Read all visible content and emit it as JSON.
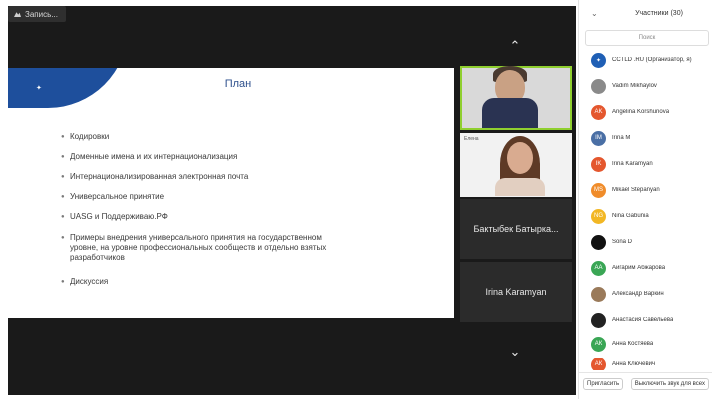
{
  "recording": {
    "label": "Запись..."
  },
  "slide": {
    "title": "План",
    "bullets": [
      "Кодировки",
      "Доменные имена и их интернационализация",
      "Интернационализированная электронная почта",
      "Универсальное принятие",
      "UASG и Поддерживаю.РФ",
      "Примеры внедрения универсального принятия на государственном уровне, на уровне профессиональных сообществ и отдельно взятых разработчиков",
      "Дискуссия"
    ]
  },
  "video_tiles": {
    "tile2_label": "Елена",
    "tile3_name": "Бактыбек Батырка...",
    "tile4_name": "Irina Karamyan"
  },
  "panel": {
    "title": "Участники (30)",
    "search_placeholder": "Поиск",
    "participants": [
      {
        "name": "CCTLD .RU (Организатор, я)",
        "initials": "",
        "color": "#1f5fb5"
      },
      {
        "name": "Vadim Mikhaylov",
        "initials": "",
        "color": "#8a8a8a"
      },
      {
        "name": "Angelina Korshunova",
        "initials": "AK",
        "color": "#e4572e"
      },
      {
        "name": "Irina M",
        "initials": "IM",
        "color": "#4a6fa5"
      },
      {
        "name": "Irina Karamyan",
        "initials": "IK",
        "color": "#e4572e"
      },
      {
        "name": "Mikael Stepanyan",
        "initials": "MS",
        "color": "#f08c2a"
      },
      {
        "name": "Nina Gabunia",
        "initials": "NG",
        "color": "#f2b724"
      },
      {
        "name": "Sona D",
        "initials": "",
        "color": "#111111"
      },
      {
        "name": "Айгарим Абжарова",
        "initials": "АА",
        "color": "#3aa655"
      },
      {
        "name": "Александр Варкин",
        "initials": "",
        "color": "#9a7a5a"
      },
      {
        "name": "Анастасия Савельева",
        "initials": "",
        "color": "#222222"
      },
      {
        "name": "Анна Костяева",
        "initials": "АК",
        "color": "#3aa655"
      },
      {
        "name": "Анна Ключевич",
        "initials": "АК",
        "color": "#e4572e"
      }
    ],
    "invite_label": "Пригласить",
    "mute_all_label": "Выключить звук для всех"
  }
}
